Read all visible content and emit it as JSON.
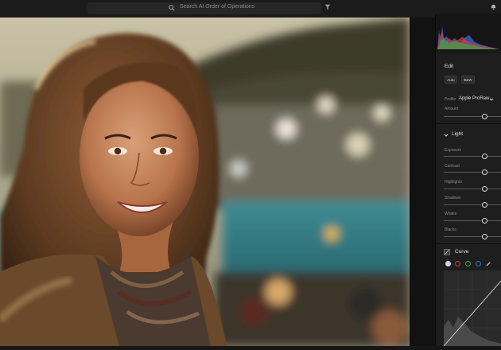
{
  "search": {
    "placeholder": "Search AI Order of Operations"
  },
  "panel": {
    "edit_title": "Edit",
    "buttons": {
      "auto": "Auto",
      "bw": "B&W"
    },
    "profile_label": "Profile",
    "profile_value": "Apple ProRaw",
    "amount_label": "Amount",
    "light_title": "Light",
    "light_sliders": [
      "Exposure",
      "Contrast",
      "Highlights",
      "Shadows",
      "Whites",
      "Blacks"
    ],
    "curve_title": "Curve"
  },
  "colors": {
    "accent": "#e8e8e8",
    "red_channel": "#d33a3a",
    "green_channel": "#3aa64a",
    "blue_channel": "#3a6ad8"
  },
  "icons": [
    "search-icon",
    "filter-icon",
    "bell-icon",
    "chevron-down-icon",
    "point-curve-icon",
    "eyedropper-icon"
  ]
}
